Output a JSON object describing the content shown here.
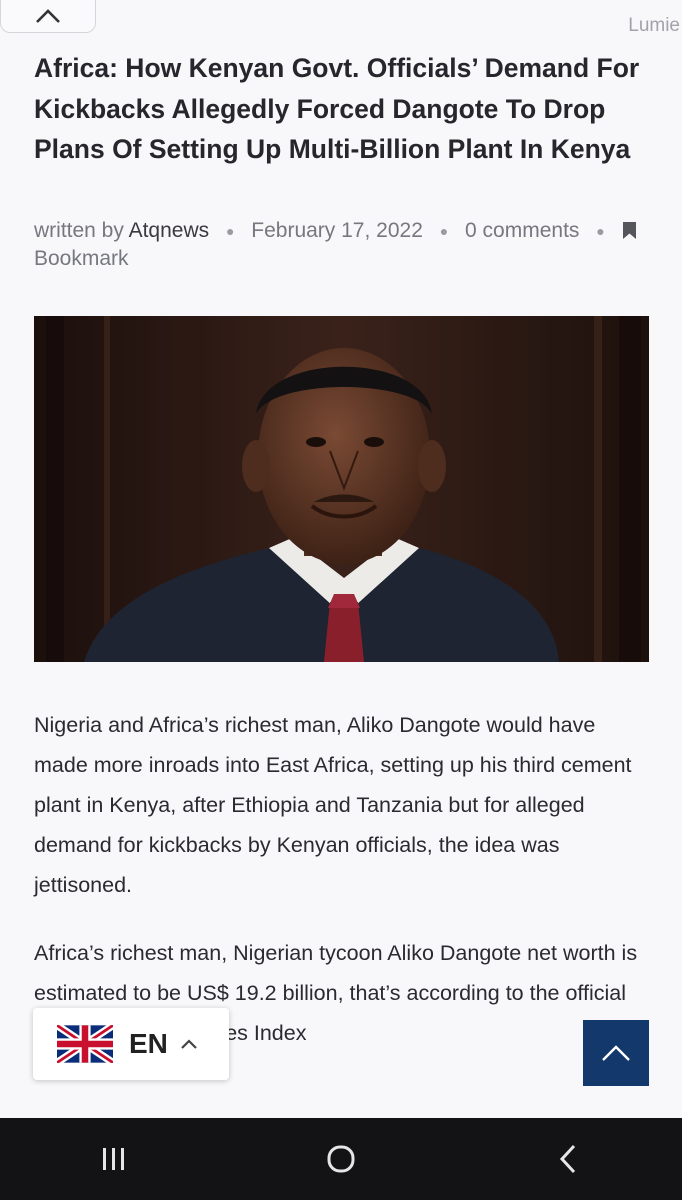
{
  "header": {
    "brand": "Lumie"
  },
  "article": {
    "title": "Africa: How Kenyan Govt. Officials’ Demand For Kickbacks Allegedly Forced Dangote To Drop Plans Of Setting Up Multi-Billion Plant In Kenya",
    "meta": {
      "written_by": "written by",
      "author": "Atqnews",
      "date": "February 17, 2022",
      "comments": "0 comments",
      "bookmark": "Bookmark"
    },
    "paragraphs": [
      "Nigeria and Africa’s richest man, Aliko Dangote would have made more inroads into East Africa, setting up his third cement plant in Kenya, after Ethiopia and Tanzania but for alleged demand for kickbacks by Kenyan officials, the idea was jettisoned.",
      "Africa’s richest man, Nigerian tycoon Aliko Dangote net worth is estimated to be US$ 19.2 billion, that’s according to the official Bloomberg Billionaires Index"
    ]
  },
  "language_switcher": {
    "code": "EN"
  },
  "icons": {
    "collapse": "chevron-up-icon",
    "bookmark": "bookmark-icon",
    "flag": "uk-flag-icon",
    "scroll_top": "chevron-up-icon",
    "nav": [
      "recent-apps-icon",
      "home-icon",
      "back-icon"
    ]
  },
  "colors": {
    "scroll_top_bg": "#13386b",
    "navbar_bg": "#131316"
  }
}
